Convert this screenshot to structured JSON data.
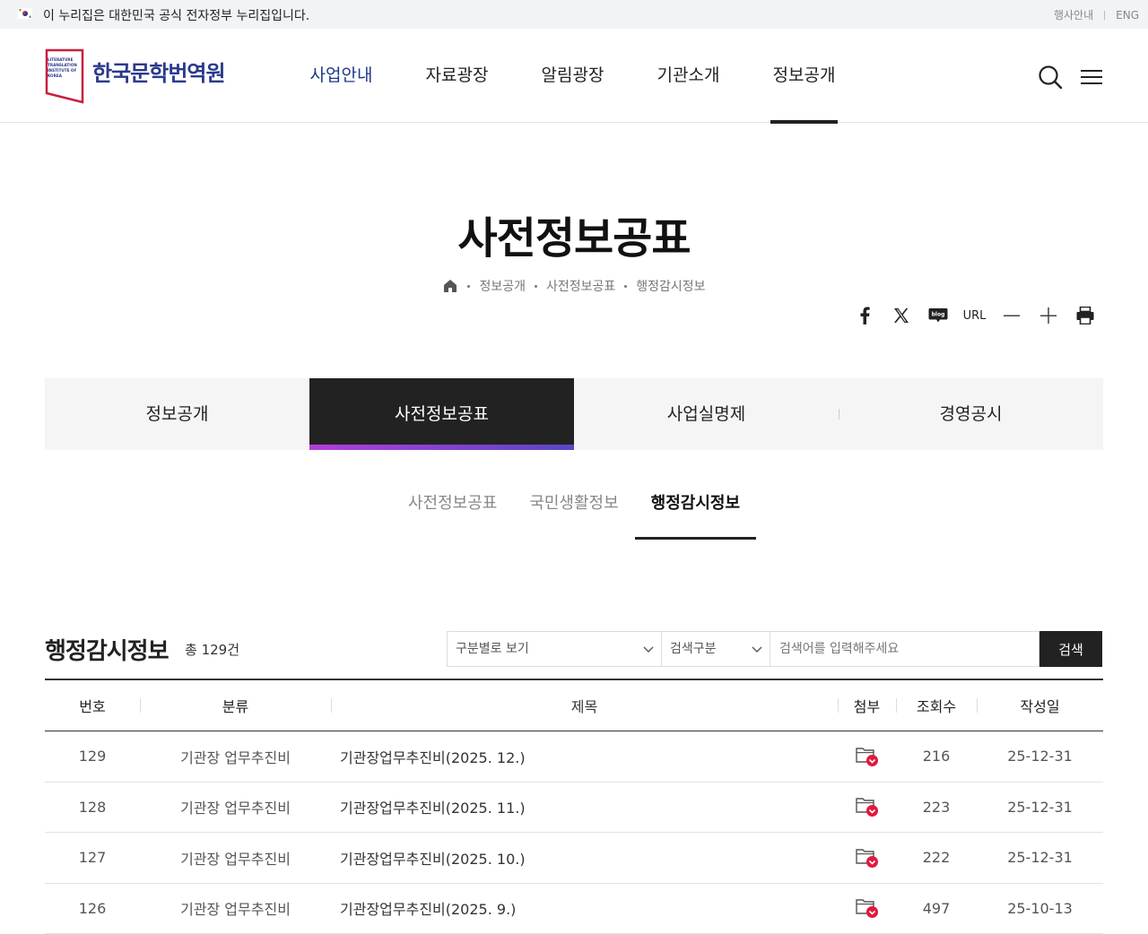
{
  "gov_banner": {
    "text": "이 누리집은 대한민국 공식 전자정부 누리집입니다.",
    "links": [
      "행사안내",
      "ENG"
    ]
  },
  "header": {
    "logo_small": [
      "LITERATURE",
      "TRANSLATION",
      "INSTITUTE OF",
      "KOREA"
    ],
    "logo_text": "한국문학번역원",
    "nav": [
      "사업안내",
      "자료광장",
      "알림광장",
      "기관소개",
      "정보공개"
    ],
    "active_nav": "정보공개"
  },
  "page": {
    "title": "사전정보공표",
    "breadcrumb": [
      "정보공개",
      "사전정보공표",
      "행정감시정보"
    ]
  },
  "share": {
    "url_label": "URL"
  },
  "tabs": [
    "정보공개",
    "사전정보공표",
    "사업실명제",
    "경영공시"
  ],
  "subtabs": [
    "사전정보공표",
    "국민생활정보",
    "행정감시정보"
  ],
  "list": {
    "title": "행정감시정보",
    "count_label": "총 129건",
    "filter1": "구분별로 보기",
    "filter2": "검색구분",
    "search_placeholder": "검색어를 입력해주세요",
    "search_button": "검색"
  },
  "table": {
    "headers": [
      "번호",
      "분류",
      "제목",
      "첨부",
      "조회수",
      "작성일"
    ],
    "rows": [
      {
        "no": "129",
        "category": "기관장 업무추진비",
        "title": "기관장업무추진비(2025. 12.)",
        "views": "216",
        "date": "25-12-31"
      },
      {
        "no": "128",
        "category": "기관장 업무추진비",
        "title": "기관장업무추진비(2025. 11.)",
        "views": "223",
        "date": "25-12-31"
      },
      {
        "no": "127",
        "category": "기관장 업무추진비",
        "title": "기관장업무추진비(2025. 10.)",
        "views": "222",
        "date": "25-12-31"
      },
      {
        "no": "126",
        "category": "기관장 업무추진비",
        "title": "기관장업무추진비(2025. 9.)",
        "views": "497",
        "date": "25-10-13"
      }
    ]
  },
  "colors": {
    "brand_blue": "#2b3a8c",
    "logo_red": "#c8203f",
    "active_tab_bg": "#222222",
    "tab_gradient": [
      "#b23fd8",
      "#5a46c7"
    ],
    "attach_badge": "#e0193f"
  }
}
